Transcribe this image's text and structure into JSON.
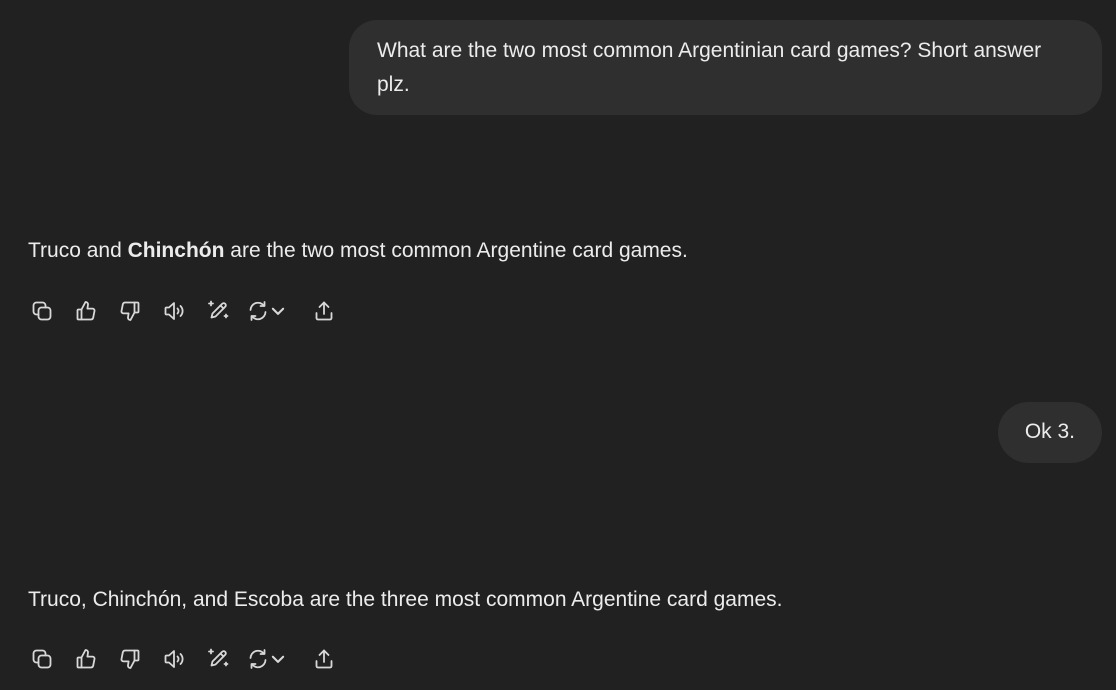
{
  "conversation": {
    "user_message_1": {
      "text": "What are the two most common Argentinian card games? Short answer plz."
    },
    "assistant_message_1": {
      "part1": "Truco and ",
      "bold": "Chinchón",
      "part2": " are the two most common Argentine card games."
    },
    "user_message_2": {
      "text": "Ok 3."
    },
    "assistant_message_2": {
      "text": "Truco, Chinchón, and Escoba are the three most common Argentine card games."
    }
  },
  "action_icons": [
    "copy-icon",
    "thumbs-up-icon",
    "thumbs-down-icon",
    "read-aloud-icon",
    "edit-icon",
    "regenerate-icon",
    "chevron-down-icon",
    "share-icon"
  ],
  "colors": {
    "background": "#212121",
    "user_bubble": "#2f2f2f",
    "text": "#ececec",
    "icon": "#d8d8d8"
  }
}
